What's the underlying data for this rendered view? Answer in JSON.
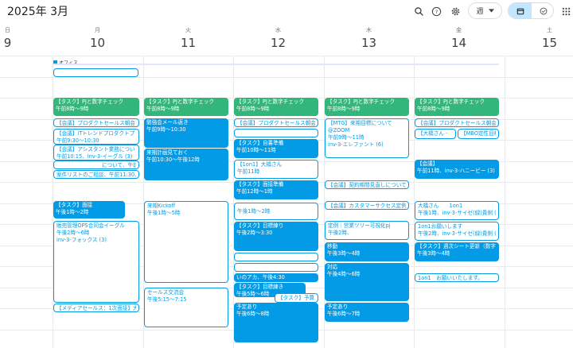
{
  "header": {
    "title": "2025年 3月",
    "view_label": "週"
  },
  "icons": {
    "search": "search-icon",
    "help": "help-icon",
    "settings": "gear-icon",
    "dropdown": "chevron-down-icon",
    "calendar": "calendar-icon",
    "tasks": "check-icon",
    "apps": "apps-grid-icon"
  },
  "days": [
    {
      "dow": "日",
      "num": "9"
    },
    {
      "dow": "月",
      "num": "10"
    },
    {
      "dow": "火",
      "num": "11"
    },
    {
      "dow": "水",
      "num": "12"
    },
    {
      "dow": "木",
      "num": "13"
    },
    {
      "dow": "金",
      "num": "14"
    },
    {
      "dow": "土",
      "num": "15"
    }
  ],
  "allday": {
    "label": "オフィス"
  },
  "events": [
    {
      "t": "【タスク】PJと数字チェック",
      "s": "午前8時〜9時",
      "c": "g"
    },
    {
      "t": "【タスク】PJと数字チェック",
      "s": "午前8時〜9時",
      "c": "g"
    },
    {
      "t": "【タスク】PJと数字チェック",
      "s": "午前8時〜9時",
      "c": "g"
    },
    {
      "t": "【タスク】PJと数字チェック",
      "s": "午前8時〜9時",
      "c": "g"
    },
    {
      "t": "【タスク】PJと数字チェック",
      "s": "午前8時〜9時",
      "c": "g"
    },
    {
      "t": "【会議】プロダクトセールス朝会",
      "s": "",
      "c": "o"
    },
    {
      "t": "【会議】iTトレンドプロダクトプ",
      "s": "午前9:30〜10:30",
      "c": "o"
    },
    {
      "t": "【会議】アシスタント業務につい",
      "s": "午前10:15、inv-3-イーグル (3)",
      "c": "o"
    },
    {
      "t": "について、午前10:45",
      "s": "",
      "c": "o"
    },
    {
      "t": "案件リストのご相談、午前11:30、i",
      "s": "",
      "c": "o"
    },
    {
      "t": "【タスク】面接",
      "s": "午後1時〜2時",
      "c": "b"
    },
    {
      "t": "販売管理OPS合同会イーグル",
      "s": "午後2時〜6時",
      "s2": "inv-3-フォックス (3)",
      "c": "o"
    },
    {
      "t": "【メディアセールス：1次面接】大",
      "s": "",
      "c": "o"
    },
    {
      "t": "勉強会メール返き",
      "s": "午前9時〜10:30",
      "c": "b"
    },
    {
      "t": "来期計画見ておく",
      "s": "午前10:30〜午後12時",
      "c": "b"
    },
    {
      "t": "来期Kickoff",
      "s": "午後1時〜5時",
      "c": "o"
    },
    {
      "t": "セールス交流会",
      "s": "午後5:15〜7:15",
      "c": "o"
    },
    {
      "t": "【会議】プロダクトセールス朝会",
      "s": "",
      "c": "o"
    },
    {
      "t": "【タスク】自書準備",
      "s": "午前10時〜11時",
      "c": "b"
    },
    {
      "t": "【1on1】大橋さん",
      "s": "午前11時",
      "c": "o"
    },
    {
      "t": "【タスク】面接準備",
      "s": "午前12時〜1時",
      "c": "b"
    },
    {
      "t": "午後1時〜2時",
      "s": "",
      "c": "o"
    },
    {
      "t": "【タスク】目標練り",
      "s": "午後2時〜3:30",
      "c": "b"
    },
    {
      "t": "いのアカ、午後4:30",
      "s": "",
      "c": "b"
    },
    {
      "t": "【タスク】目標練き",
      "s": "午後5時〜6時",
      "c": "b"
    },
    {
      "t": "【タスク】予算",
      "s": "",
      "c": "o"
    },
    {
      "t": "予定あり",
      "s": "午後6時〜8時",
      "c": "b"
    },
    {
      "t": "【MTG】来期目標について",
      "s": "@ZOOM",
      "s2": "午前9時〜11時",
      "s3": "inv-3-エレファント (6)",
      "c": "o"
    },
    {
      "t": "【会議】契約期間見直しについてご相",
      "s": "",
      "c": "o"
    },
    {
      "t": "【会議】カスタマーサクセス定例",
      "s": "",
      "c": "o"
    },
    {
      "t": "定例｜営業ツリー可視化pj",
      "s": "午後2時、",
      "c": "o"
    },
    {
      "t": "移動",
      "s": "午後3時〜4時",
      "c": "b"
    },
    {
      "t": "対応",
      "s": "午後4時〜6時",
      "c": "b"
    },
    {
      "t": "予定あり",
      "s": "午後6時〜7時",
      "c": "b"
    },
    {
      "t": "【会議】プロダクトセールス朝会",
      "s": "",
      "c": "o"
    },
    {
      "t": "【大橋さん -",
      "s": "",
      "c": "o"
    },
    {
      "t": "【MBO定性目標",
      "s": "",
      "c": "o"
    },
    {
      "t": "【会議】",
      "s": "午前11時、inv-3-ハニービー (3)",
      "c": "b"
    },
    {
      "t": "大橋さん　　1on1",
      "s": "午後1時、inv-3-サイゼ(緑)貴俐 (4)",
      "c": "o"
    },
    {
      "t": "1on1お願いします",
      "s": "午後2時、inv-3-サイゼ(緑)貴俐 (4)",
      "c": "o"
    },
    {
      "t": "【タスク】週次シート更新（数字",
      "s": "午後3時〜4時",
      "c": "b"
    },
    {
      "t": "1on1　お願いいたします。",
      "s": "",
      "c": "o"
    }
  ]
}
